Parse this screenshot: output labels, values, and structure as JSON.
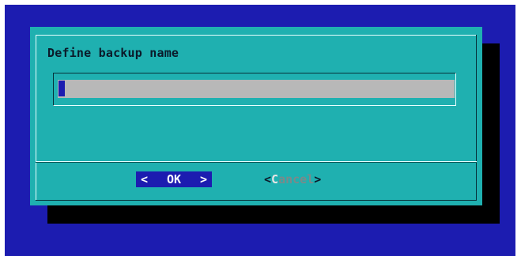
{
  "dialog": {
    "title": "Define backup name",
    "input": {
      "value": "",
      "placeholder": ""
    },
    "buttons": {
      "ok": {
        "left_bracket": "<",
        "label": "OK",
        "right_bracket": ">"
      },
      "cancel": {
        "left_bracket": "<",
        "hotkey": "C",
        "rest": "ancel",
        "right_bracket": ">"
      }
    }
  },
  "colors": {
    "backdrop": "#1c1cb0",
    "dialog": "#1fb0b0",
    "input": "#b8b8b8",
    "focus": "#1c1cb0"
  }
}
